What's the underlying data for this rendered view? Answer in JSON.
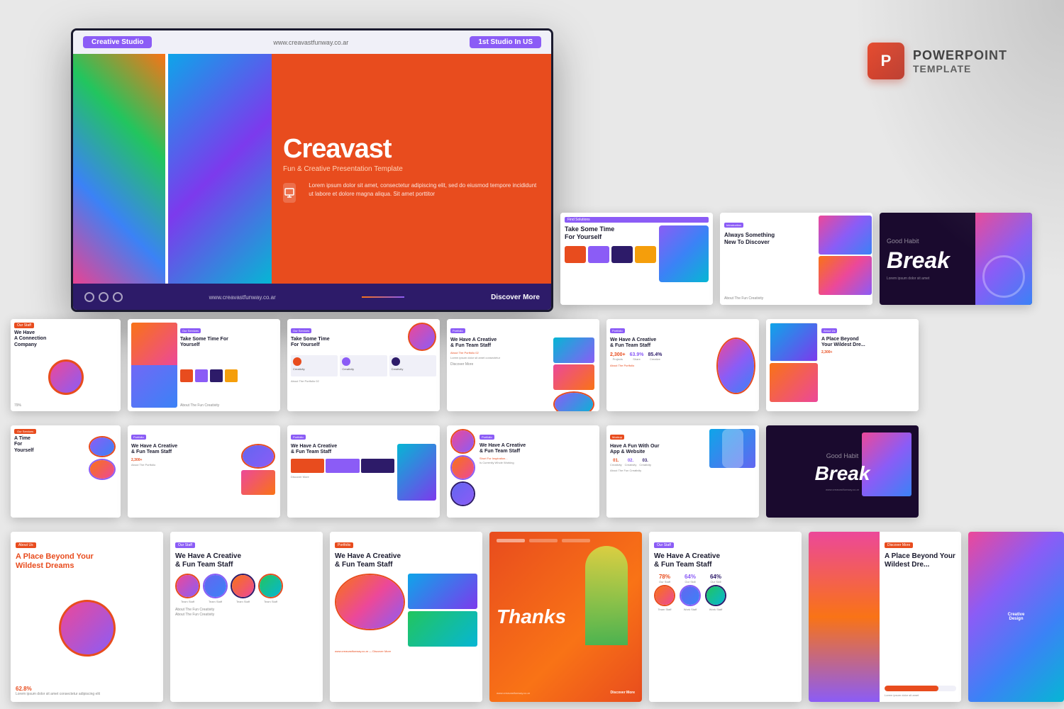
{
  "brand": {
    "ppt_icon": "P",
    "ppt_label_main": "POWERPOINT",
    "ppt_label_sub": "TEMPLATE"
  },
  "main_slide": {
    "tag_left": "Creative Studio",
    "url": "www.creavastfunway.co.ar",
    "tag_right": "1st Studio In US",
    "title": "Creavast",
    "subtitle": "Fun & Creative Presentation Template",
    "description": "Lorem ipsum dolor sit amet, consectetur adipiscing elit, sed do eiusmod tempore incididunt ut labore et dolore magna aliqua. Sit amet porttitor",
    "bottom_url": "www.creavastfunway.co.ar",
    "discover": "Discover More"
  },
  "slides": {
    "r1": [
      {
        "title": "Take Some Time For Yourself",
        "tag": "Find Solutions"
      },
      {
        "title": "Always Something New To Discover",
        "tag": "Introduction"
      },
      {
        "title": "Break",
        "tag": ""
      }
    ],
    "r2": [
      {
        "title": "A Connection Company",
        "tag": "Our Staff"
      },
      {
        "title": "Take Some Time For Yourself",
        "tag": "Our Services"
      },
      {
        "title": "Take Some Time For Yourself",
        "tag": "Our Services"
      },
      {
        "title": "We Have A Creative & Fun Team Staff",
        "tag": "Portfolio"
      },
      {
        "title": "We Have A Creative & Fun Team Staff",
        "tag": "Portfolio"
      },
      {
        "title": "A Place Beyond Your Wildest Dre...",
        "tag": "About Us"
      }
    ],
    "r3": [
      {
        "title": "A Time For Yourself",
        "tag": "Our Services"
      },
      {
        "title": "We Have A Creative & Fun Team Staff",
        "tag": "Portfolio"
      },
      {
        "title": "We Have A Creative & Fun Team Staff",
        "tag": "Portfolio"
      },
      {
        "title": "We Have A Creative & Fun Team Staff",
        "tag": "Portfolio"
      },
      {
        "title": "Have A Fun With Our App & Website",
        "tag": "Mockup"
      },
      {
        "title": "Break",
        "tag": ""
      }
    ],
    "r4": [
      {
        "title": "A Place Beyond Your Wildest Dreams",
        "tag": "About Us",
        "stat": "62.8%"
      },
      {
        "title": "We Have A Creative & Fun Team Staff",
        "tag": "Our Staff"
      },
      {
        "title": "We Have A Creative & Fun Team Staff",
        "tag": "Portfolio"
      },
      {
        "title": "Thanks",
        "tag": ""
      },
      {
        "title": "We Have A Creative & Fun Team Staff",
        "tag": "Our Staff",
        "stat": "78% 64% 64%"
      },
      {
        "title": "A Place Beyond Your Wildest Dre...",
        "tag": "Discover More"
      }
    ]
  },
  "colors": {
    "orange": "#e84c1e",
    "purple": "#2d1b69",
    "violet": "#8b5cf6",
    "light_bg": "#e8e8e8"
  }
}
